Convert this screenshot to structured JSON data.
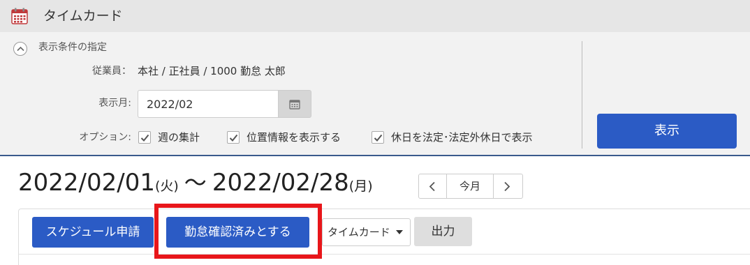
{
  "header": {
    "title": "タイムカード",
    "icon": "calendar-icon"
  },
  "conditions": {
    "heading": "表示条件の指定",
    "employee_label": "従業員：",
    "employee_value": "本社 / 正社員 / 1000 勤怠 太郎",
    "month_label": "表示月:",
    "month_value": "2022/02",
    "options_label": "オプション:",
    "options": [
      {
        "label": "週の集計",
        "checked": true
      },
      {
        "label": "位置情報を表示する",
        "checked": true
      },
      {
        "label": "休日を法定･法定外休日で表示",
        "checked": true
      }
    ],
    "show_button": "表示"
  },
  "range": {
    "start_date": "2022/02/01",
    "start_day": "(火)",
    "separator": "～",
    "end_date": "2022/02/28",
    "end_day": "(月)"
  },
  "pager": {
    "today_label": "今月"
  },
  "toolbar": {
    "schedule_button": "スケジュール申請",
    "confirm_button": "勤怠確認済みとする",
    "view_select": "タイムカード",
    "output_button": "出力"
  },
  "colors": {
    "primary": "#2b5bc5",
    "highlight": "#e8161a",
    "panel_bg": "#f2f2f2",
    "header_bg": "#e6e6e6"
  }
}
